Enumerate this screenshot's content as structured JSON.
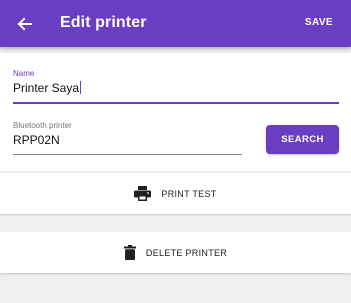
{
  "appbar": {
    "title": "Edit printer",
    "back_icon": "arrow-left-icon",
    "save_label": "SAVE",
    "color": "#6a3ec2"
  },
  "form": {
    "name_label": "Name",
    "name_value": "Printer Saya",
    "bluetooth_label": "Bluetooth printer",
    "bluetooth_value": "RPP02N",
    "search_label": "SEARCH"
  },
  "actions": {
    "print_test": {
      "label": "PRINT TEST",
      "icon": "printer-icon"
    },
    "delete_printer": {
      "label": "DELETE PRINTER",
      "icon": "trash-icon"
    }
  }
}
